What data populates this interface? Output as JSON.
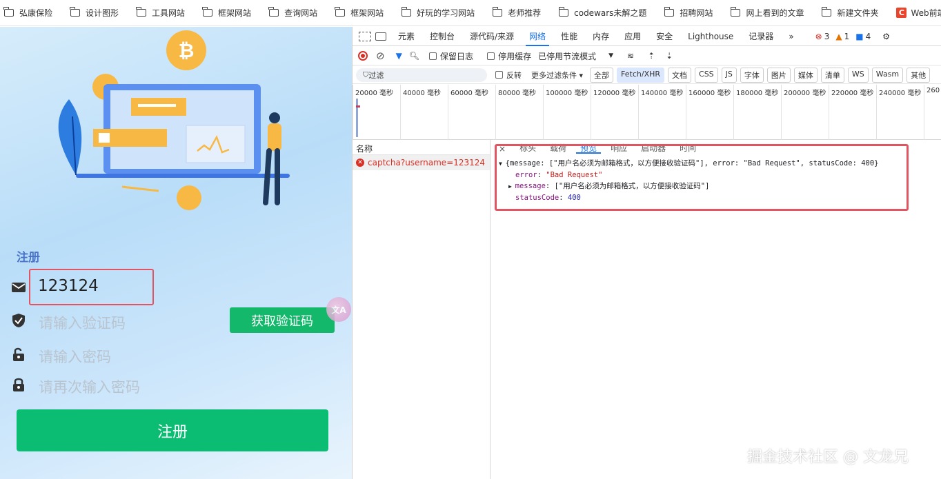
{
  "bookmarks": [
    {
      "label": "弘康保险",
      "icon": "folder-icon"
    },
    {
      "label": "设计图形",
      "icon": "folder-icon"
    },
    {
      "label": "工具网站",
      "icon": "folder-icon"
    },
    {
      "label": "框架网站",
      "icon": "folder-icon"
    },
    {
      "label": "查询网站",
      "icon": "folder-icon"
    },
    {
      "label": "框架网站",
      "icon": "folder-icon"
    },
    {
      "label": "好玩的学习网站",
      "icon": "folder-icon"
    },
    {
      "label": "老师推荐",
      "icon": "folder-icon"
    },
    {
      "label": "codewars未解之题",
      "icon": "folder-icon"
    },
    {
      "label": "招聘网站",
      "icon": "folder-icon"
    },
    {
      "label": "网上看到的文章",
      "icon": "folder-icon"
    },
    {
      "label": "新建文件夹",
      "icon": "folder-icon"
    },
    {
      "label": "Web前端单词大全...",
      "icon": "c-badge-icon",
      "badge": "C"
    }
  ],
  "register": {
    "title": "注册",
    "username_value": "123124",
    "code_placeholder": "请输入验证码",
    "password_placeholder": "请输入密码",
    "password2_placeholder": "请再次输入密码",
    "get_code_label": "获取验证码",
    "submit_label": "注册",
    "fab_text": "文A"
  },
  "devtools": {
    "tabs": [
      "元素",
      "控制台",
      "源代码/来源",
      "网络",
      "性能",
      "内存",
      "应用",
      "安全",
      "Lighthouse",
      "记录器"
    ],
    "active_tab": "网络",
    "more": "»",
    "errors": "3",
    "warnings": "1",
    "messages": "4",
    "toolbar": {
      "preserve_log": "保留日志",
      "disable_cache": "停用缓存",
      "throttle": "已停用节流模式"
    },
    "filter": {
      "placeholder": "过滤",
      "invert": "反转",
      "more_filters": "更多过滤条件 ▾",
      "chips": [
        "全部",
        "Fetch/XHR",
        "文档",
        "CSS",
        "JS",
        "字体",
        "图片",
        "媒体",
        "清单",
        "WS",
        "Wasm",
        "其他"
      ],
      "active_chip": "Fetch/XHR"
    },
    "timeline_ticks": [
      "20000 毫秒",
      "40000 毫秒",
      "60000 毫秒",
      "80000 毫秒",
      "100000 毫秒",
      "120000 毫秒",
      "140000 毫秒",
      "160000 毫秒",
      "180000 毫秒",
      "200000 毫秒",
      "220000 毫秒",
      "240000 毫秒",
      "260"
    ],
    "name_header": "名称",
    "request": "captcha?username=123124",
    "preview_tabs": [
      "×",
      "标头",
      "载荷",
      "预览",
      "响应",
      "启动器",
      "时间"
    ],
    "active_preview_tab": "预览",
    "preview": {
      "summary": "{message: [\"用户名必须为邮箱格式，以方便接收验证码\"], error: \"Bad Request\", statusCode: 400}",
      "error_key": "error",
      "error_val": "\"Bad Request\"",
      "message_key": "message",
      "message_val": "[\"用户名必须为邮箱格式，以方便接收验证码\"]",
      "status_key": "statusCode",
      "status_val": "400"
    }
  },
  "watermark": "掘金技术社区 @ 文龙兄",
  "colors": {
    "accent": "#1a73e8",
    "green": "#0bbd73",
    "highlight_red": "#e05561"
  }
}
